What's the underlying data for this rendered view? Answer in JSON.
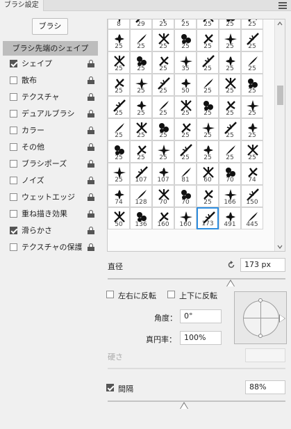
{
  "panel": {
    "tab_title": "ブラシ設定"
  },
  "preset_button": "ブラシ",
  "left_panel": {
    "header": "ブラシ先端のシェイプ",
    "items": [
      {
        "label": "シェイプ",
        "checked": true
      },
      {
        "label": "散布",
        "checked": false
      },
      {
        "label": "テクスチャ",
        "checked": false
      },
      {
        "label": "デュアルブラシ",
        "checked": false
      },
      {
        "label": "カラー",
        "checked": false
      },
      {
        "label": "その他",
        "checked": false
      },
      {
        "label": "ブラシポーズ",
        "checked": false
      },
      {
        "label": "ノイズ",
        "checked": false
      },
      {
        "label": "ウェットエッジ",
        "checked": false
      },
      {
        "label": "重ね描き効果",
        "checked": false
      },
      {
        "label": "滑らかさ",
        "checked": true
      },
      {
        "label": "テクスチャの保護",
        "checked": false
      }
    ]
  },
  "brush_grid": {
    "rows": [
      [
        "8",
        "29",
        "25",
        "25",
        "25",
        "25",
        "25"
      ],
      [
        "25",
        "25",
        "25",
        "25",
        "25",
        "25",
        "25"
      ],
      [
        "25",
        "25",
        "25",
        "35",
        "25",
        "25",
        "25"
      ],
      [
        "25",
        "25",
        "25",
        "50",
        "25",
        "25",
        "25"
      ],
      [
        "25",
        "25",
        "25",
        "25",
        "25",
        "25",
        "25"
      ],
      [
        "25",
        "25",
        "25",
        "25",
        "25",
        "25",
        "25"
      ],
      [
        "25",
        "25",
        "25",
        "25",
        "25",
        "25",
        "25"
      ],
      [
        "25",
        "107",
        "107",
        "81",
        "60",
        "70",
        "74"
      ],
      [
        "74",
        "128",
        "70",
        "70",
        "25",
        "166",
        "150"
      ],
      [
        "50",
        "136",
        "160",
        "160",
        "173",
        "491",
        "445"
      ]
    ],
    "selected": {
      "row": 9,
      "col": 4
    }
  },
  "diameter": {
    "label": "直径",
    "value": "173 px",
    "slider_fraction": 0.69
  },
  "flip_x": {
    "label": "左右に反転",
    "checked": false
  },
  "flip_y": {
    "label": "上下に反転",
    "checked": false
  },
  "angle": {
    "label": "角度：",
    "value": "0°"
  },
  "roundness": {
    "label": "真円率：",
    "value": "100%"
  },
  "hardness": {
    "label": "硬さ",
    "value": ""
  },
  "spacing": {
    "label": "間隔",
    "checked": true,
    "value": "88%",
    "slider_fraction": 0.43
  }
}
